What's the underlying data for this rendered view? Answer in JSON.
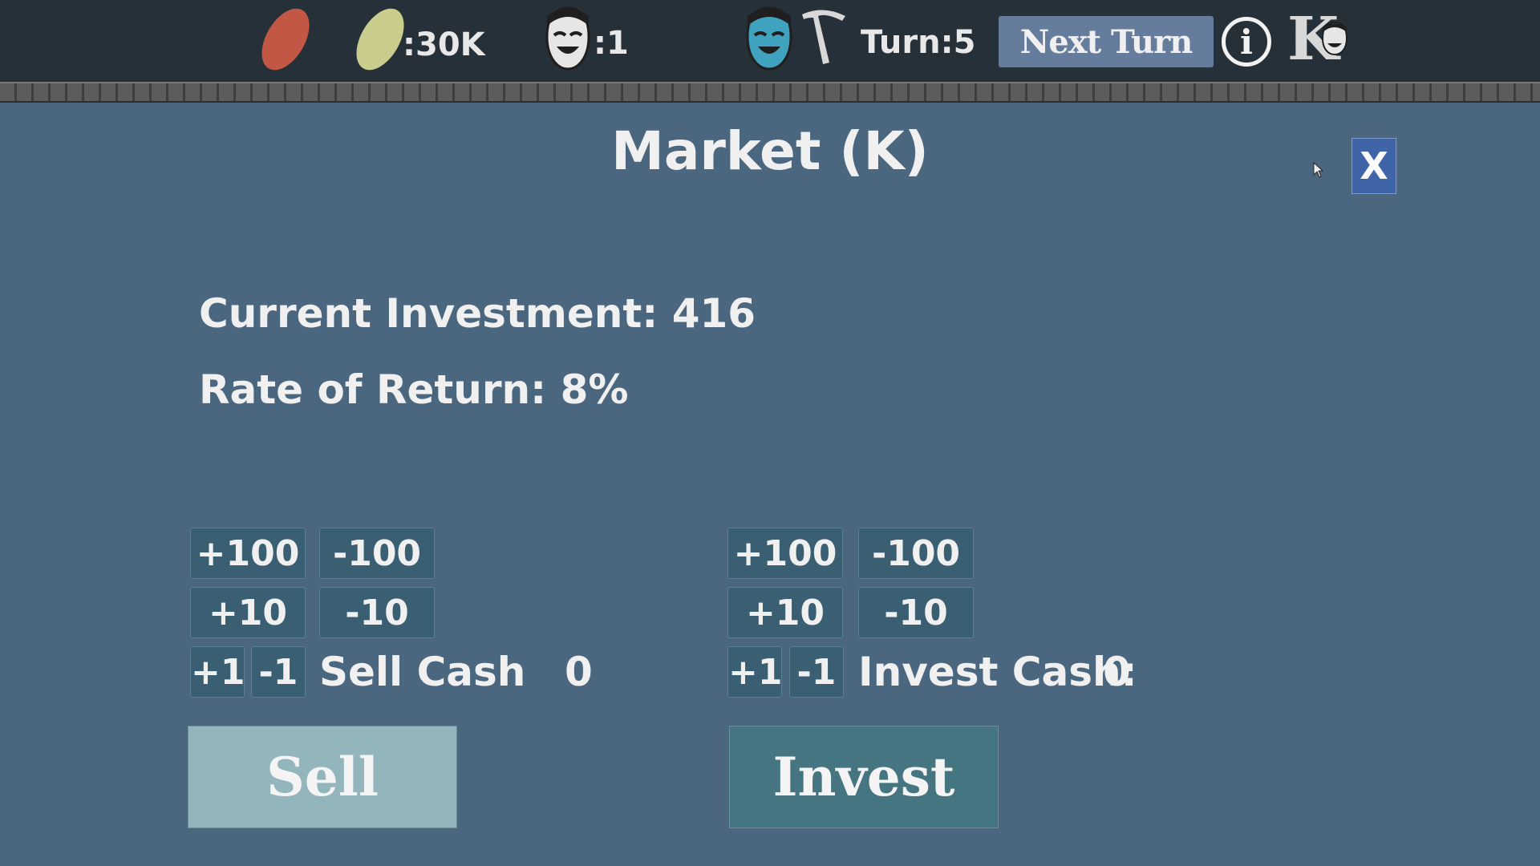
{
  "topbar": {
    "resources": [
      {
        "icon": "red-seed-icon",
        "color": "#c25745",
        "value": ""
      },
      {
        "icon": "yellow-seed-icon",
        "color": "#c9cc8c",
        "value": ":30K"
      }
    ],
    "population": {
      "icon": "white-mask-icon",
      "value": ":1"
    },
    "player": {
      "icon": "blue-mask-icon",
      "color": "#3fa3c0"
    },
    "turn_label": "Turn:",
    "turn_value": "5",
    "next_turn_label": "Next Turn",
    "info_label": "i",
    "market_shortcut_letter": "K"
  },
  "market": {
    "title": "Market (K)",
    "close_label": "X",
    "current_investment_label": "Current Investment:",
    "current_investment_value": "416",
    "rate_label": "Rate of Return:",
    "rate_value": "8%",
    "sell": {
      "steps": [
        "+100",
        "-100",
        "+10",
        "-10",
        "+1",
        "-1"
      ],
      "cash_label": "Sell Cash",
      "cash_value": "0",
      "button_label": "Sell"
    },
    "invest": {
      "steps": [
        "+100",
        "-100",
        "+10",
        "-10",
        "+1",
        "-1"
      ],
      "cash_label": "Invest Cash:",
      "cash_value": "0",
      "button_label": "Invest"
    }
  }
}
